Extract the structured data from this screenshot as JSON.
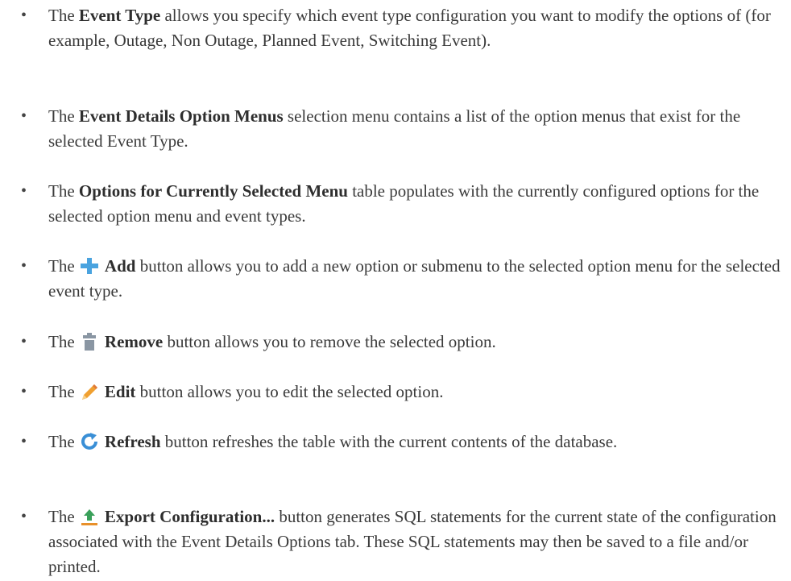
{
  "items": [
    {
      "pre": "The ",
      "bold": "Event Type",
      "post": " allows you specify which event type configuration you want to modify the options of (for example, Outage, Non Outage, Planned Event, Switching Event)."
    },
    {
      "pre": "The ",
      "bold": "Event Details Option Menus",
      "post": " selection menu contains a list of the option menus that exist for the selected Event Type."
    },
    {
      "pre": "The ",
      "bold": "Options for Currently Selected Menu",
      "post": " table populates with the currently configured options for the selected option menu and event types."
    },
    {
      "pre": "The ",
      "icon": "plus-icon",
      "bold": "Add",
      "post": " button allows you to add a new option or submenu to the selected option menu for the selected event type."
    },
    {
      "pre": "The ",
      "icon": "trash-icon",
      "bold": "Remove",
      "post": " button allows you to remove the selected option."
    },
    {
      "pre": "The ",
      "icon": "pencil-icon",
      "bold": "Edit",
      "post": " button allows you to edit the selected option."
    },
    {
      "pre": "The ",
      "icon": "refresh-icon",
      "bold": "Refresh",
      "post": " button refreshes the table with the current contents of the database."
    },
    {
      "pre": "The ",
      "icon": "export-icon",
      "bold": "Export Configuration...",
      "post": " button generates SQL statements for the current state of the configuration associated with the Event Details Options tab. These SQL statements may then be saved to a file and/or printed."
    }
  ],
  "colors": {
    "plus": "#4aa3df",
    "trash": "#8a96a3",
    "pencil": "#f0a030",
    "refresh": "#3a8fd6",
    "export": "#3aa05a"
  }
}
